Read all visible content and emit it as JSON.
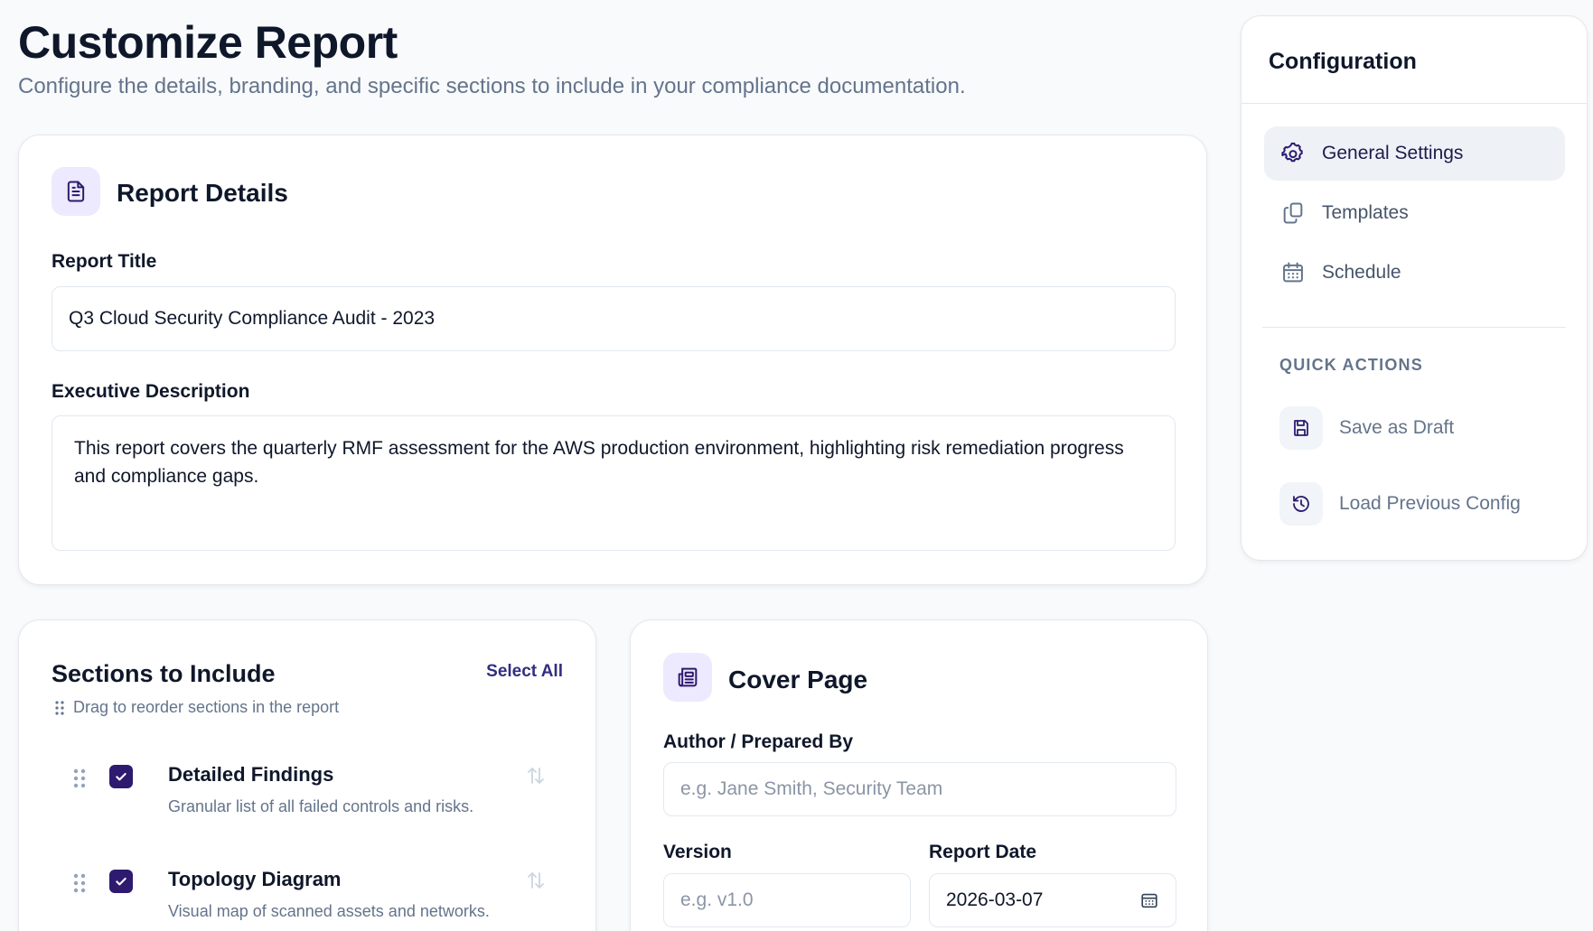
{
  "header": {
    "title": "Customize Report",
    "subtitle": "Configure the details, branding, and specific sections to include in your compliance documentation."
  },
  "report_details": {
    "heading": "Report Details",
    "icon": "document-icon",
    "title_label": "Report Title",
    "title_value": "Q3 Cloud Security Compliance Audit - 2023",
    "description_label": "Executive Description",
    "description_value": "This report covers the quarterly RMF assessment for the AWS production environment, highlighting risk remediation progress and compliance gaps."
  },
  "sections": {
    "heading": "Sections to Include",
    "select_all_label": "Select All",
    "drag_hint": "Drag to reorder sections in the report",
    "items": [
      {
        "title": "Detailed Findings",
        "description": "Granular list of all failed controls and risks.",
        "checked": true
      },
      {
        "title": "Topology Diagram",
        "description": "Visual map of scanned assets and networks.",
        "checked": true
      }
    ]
  },
  "cover_page": {
    "heading": "Cover Page",
    "icon": "newspaper-icon",
    "author_label": "Author / Prepared By",
    "author_placeholder": "e.g. Jane Smith, Security Team",
    "version_label": "Version",
    "version_placeholder": "e.g. v1.0",
    "date_label": "Report Date",
    "date_value": "2026-03-07"
  },
  "configuration": {
    "title": "Configuration",
    "nav": [
      {
        "label": "General Settings",
        "icon": "gear-icon",
        "active": true
      },
      {
        "label": "Templates",
        "icon": "copy-icon",
        "active": false
      },
      {
        "label": "Schedule",
        "icon": "calendar-icon",
        "active": false
      }
    ],
    "quick_actions_heading": "QUICK ACTIONS",
    "quick_actions": [
      {
        "label": "Save as Draft",
        "icon": "save-icon"
      },
      {
        "label": "Load Previous Config",
        "icon": "history-icon"
      }
    ]
  },
  "colors": {
    "accent": "#2e1a6e",
    "accent_light": "#ede9fe",
    "background": "#f8fafc",
    "muted_text": "#64748b"
  }
}
